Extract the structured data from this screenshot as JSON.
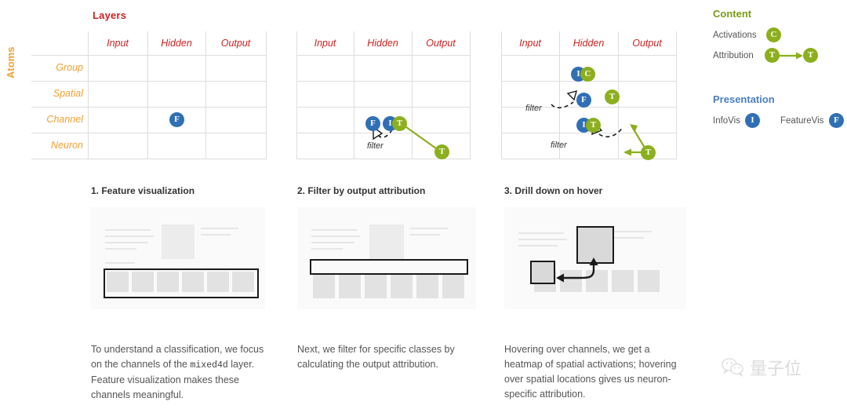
{
  "matrix_section": {
    "title": "Layers",
    "axis_label": "Atoms",
    "columns": [
      "Input",
      "Hidden",
      "Output"
    ],
    "rows": [
      "Group",
      "Spatial",
      "Channel",
      "Neuron"
    ],
    "panel1": {
      "badges": [
        {
          "letter": "F",
          "kind": "featurevis"
        }
      ]
    },
    "panel2": {
      "badges": [
        {
          "letter": "F",
          "kind": "featurevis"
        },
        {
          "letter": "I",
          "kind": "infovis"
        },
        {
          "letter": "T",
          "kind": "attribution"
        },
        {
          "letter": "T",
          "kind": "attribution"
        }
      ],
      "annotations": [
        "filter"
      ]
    },
    "panel3": {
      "badges": [
        {
          "letter": "I",
          "kind": "infovis"
        },
        {
          "letter": "C",
          "kind": "activations"
        },
        {
          "letter": "F",
          "kind": "featurevis"
        },
        {
          "letter": "T",
          "kind": "attribution"
        },
        {
          "letter": "I",
          "kind": "infovis"
        },
        {
          "letter": "T",
          "kind": "attribution"
        },
        {
          "letter": "T",
          "kind": "attribution"
        }
      ],
      "annotations": [
        "filter",
        "filter"
      ]
    }
  },
  "legend": {
    "content": {
      "heading": "Content",
      "items": [
        {
          "label": "Activations",
          "badge": "C",
          "kind": "activations"
        },
        {
          "label": "Attribution",
          "badge": "T",
          "kind": "attribution",
          "badge2": "T"
        }
      ]
    },
    "presentation": {
      "heading": "Presentation",
      "items": [
        {
          "label": "InfoVis",
          "badge": "I",
          "kind": "infovis"
        },
        {
          "label": "FeatureVis",
          "badge": "F",
          "kind": "featurevis"
        }
      ]
    }
  },
  "steps": [
    {
      "title": "1. Feature visualization",
      "caption_parts": [
        "To understand a classification, we focus on the channels of the ",
        "mixed4d",
        " layer. Feature visualization makes these channels meaningful."
      ]
    },
    {
      "title": "2. Filter by output attribution",
      "caption": "Next, we filter for specific classes by calculating the output attribution."
    },
    {
      "title": "3. Drill down on hover",
      "caption": "Hovering over channels, we get a heatmap of spatial activations; hovering over spatial locations gives us neuron-specific attribution."
    }
  ],
  "watermark": {
    "text": "量子位",
    "icon": "wechat-icon"
  },
  "colors": {
    "title_red": "#cc2222",
    "atoms_orange": "#f0a030",
    "blue": "#2f6fb5",
    "green": "#8caf1e",
    "content_green": "#7a9c14",
    "presentation_blue": "#4a7fc1"
  }
}
